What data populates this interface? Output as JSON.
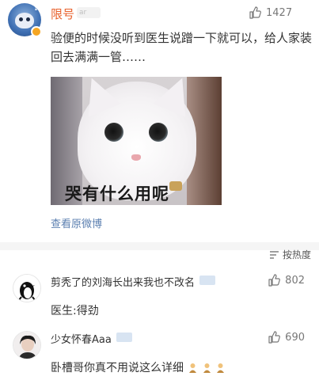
{
  "post": {
    "username": "限号",
    "user_tag": "ar",
    "like_count": "1427",
    "text": "验便的时候没听到医生说蹭一下就可以，给人家装回去满满一管……",
    "image_caption": "哭有什么用呢",
    "view_original_label": "查看原微博",
    "username_color": "#e8612c"
  },
  "sort": {
    "label": "按热度"
  },
  "comments": [
    {
      "username": "剪秃了的刘海长出来我也不改名",
      "like_count": "802",
      "text": "医生:得劲"
    },
    {
      "username": "少女怀春Aaa",
      "like_count": "690",
      "text": "卧槽哥你真不用说这么详细",
      "emoji_icons": [
        "person-emoji-icon",
        "person-emoji-icon",
        "person-emoji-icon"
      ]
    }
  ],
  "colors": {
    "link": "#5b7fb0",
    "text": "#333333",
    "meta": "#777777"
  }
}
